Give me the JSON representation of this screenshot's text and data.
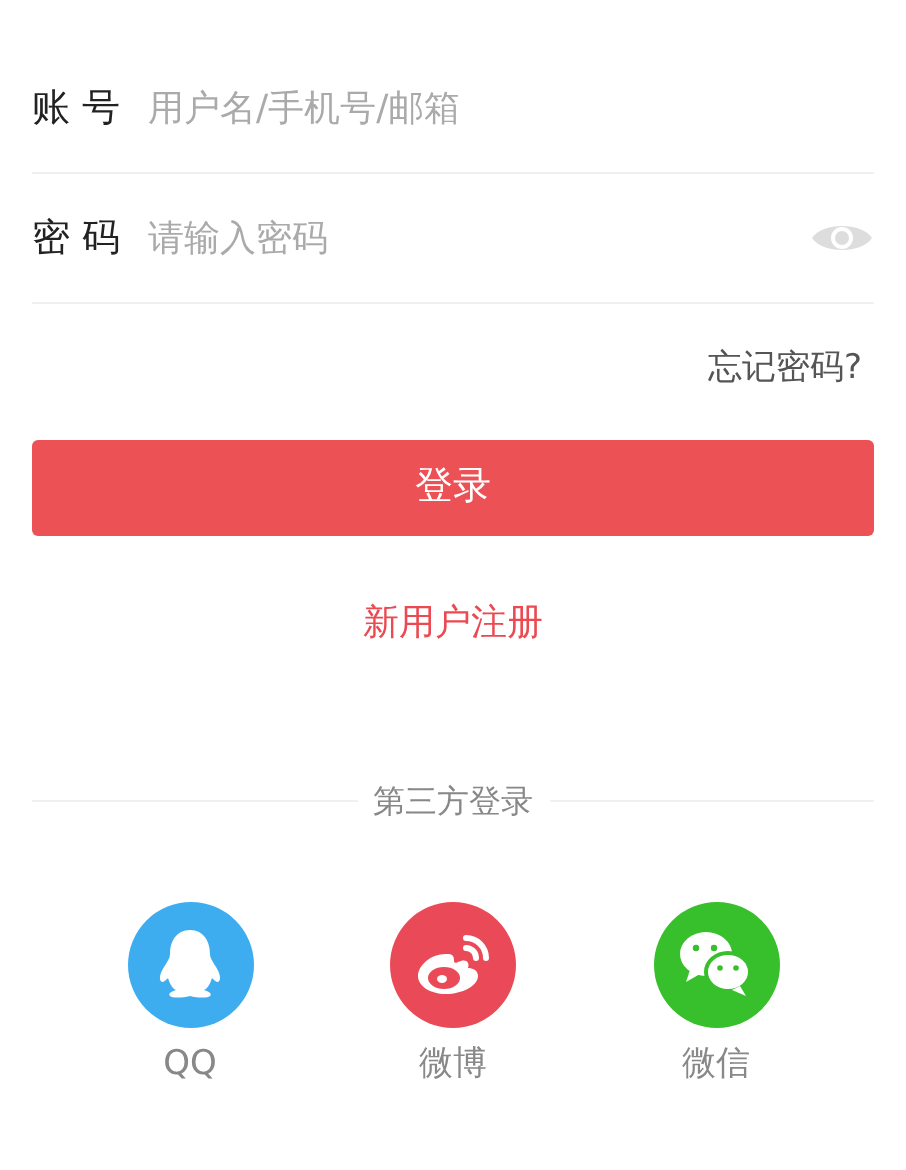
{
  "fields": [
    {
      "kind": "account",
      "label": "账 号",
      "placeholder": "用户名/手机号/邮箱"
    },
    {
      "kind": "password",
      "label": "密 码",
      "placeholder": "请输入密码"
    }
  ],
  "forgot_link": "忘记密码?",
  "login_button": "登录",
  "register_link": "新用户注册",
  "third_party": {
    "title": "第三方登录",
    "items": [
      {
        "kind": "qq",
        "label": "QQ",
        "color": "#3eadf0"
      },
      {
        "kind": "weibo",
        "label": "微博",
        "color": "#ea4a57"
      },
      {
        "kind": "wechat",
        "label": "微信",
        "color": "#37bf2c"
      }
    ]
  }
}
